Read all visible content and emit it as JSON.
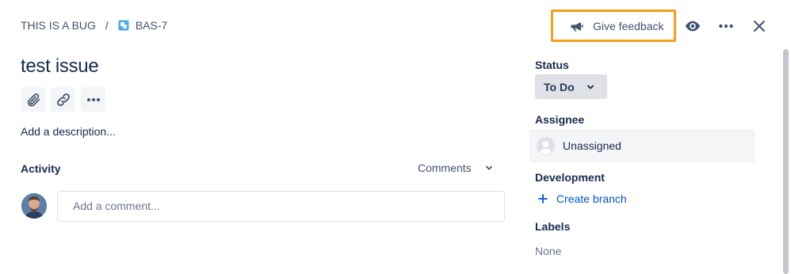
{
  "breadcrumb": {
    "parent": "THIS IS A BUG",
    "separator": "/",
    "issue_key": "BAS-7"
  },
  "issue": {
    "title": "test issue",
    "description_placeholder": "Add a description..."
  },
  "toolbar": {
    "attach_icon": "paperclip-icon",
    "link_icon": "link-icon",
    "more_icon": "more-icon"
  },
  "activity": {
    "label": "Activity",
    "filter": "Comments",
    "comment_placeholder": "Add a comment..."
  },
  "header_actions": {
    "feedback_label": "Give feedback",
    "highlight_color": "#f79e1b"
  },
  "sidebar": {
    "status_label": "Status",
    "status_value": "To Do",
    "assignee_label": "Assignee",
    "assignee_value": "Unassigned",
    "development_label": "Development",
    "create_branch": "Create branch",
    "labels_label": "Labels",
    "labels_value": "None"
  },
  "colors": {
    "link": "#0052cc",
    "text": "#172b4d",
    "subtle": "#42526e"
  }
}
